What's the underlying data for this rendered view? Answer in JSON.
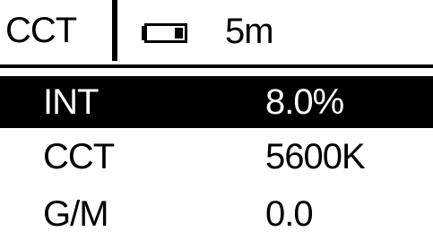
{
  "header": {
    "mode": "CCT",
    "battery_icon": "battery-icon",
    "time": "5m"
  },
  "rows": [
    {
      "label": "INT",
      "value": "8.0%",
      "selected": true
    },
    {
      "label": "CCT",
      "value": "5600K",
      "selected": false
    },
    {
      "label": "G/M",
      "value": "0.0",
      "selected": false
    }
  ],
  "colors": {
    "foreground": "#000000",
    "background": "#ffffff"
  }
}
